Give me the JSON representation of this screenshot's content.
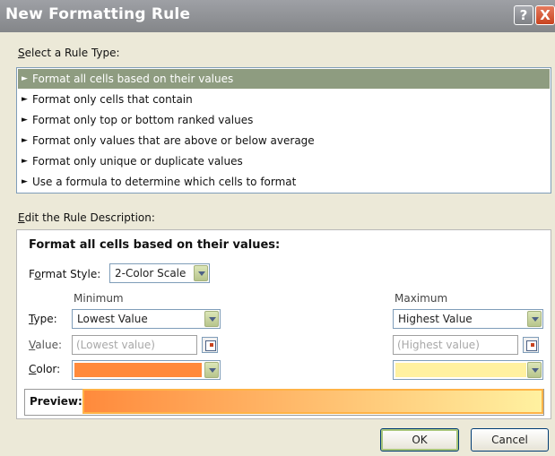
{
  "dialog": {
    "title": "New Formatting Rule",
    "help_button": "?",
    "close_button": "X"
  },
  "rule_type": {
    "label_prefix": "S",
    "label_rest": "elect a Rule Type:",
    "items": [
      {
        "label": "Format all cells based on their values",
        "selected": true
      },
      {
        "label": "Format only cells that contain",
        "selected": false
      },
      {
        "label": "Format only top or bottom ranked values",
        "selected": false
      },
      {
        "label": "Format only values that are above or below average",
        "selected": false
      },
      {
        "label": "Format only unique or duplicate values",
        "selected": false
      },
      {
        "label": "Use a formula to determine which cells to format",
        "selected": false
      }
    ],
    "arrow_glyph": "►"
  },
  "description": {
    "label_prefix": "E",
    "label_rest": "dit the Rule Description:",
    "heading": "Format all cells based on their values:",
    "format_style_label_pre": "F",
    "format_style_label_u": "o",
    "format_style_label_post": "rmat Style:",
    "format_style_value": "2-Color Scale",
    "minimum_header": "Minimum",
    "maximum_header": "Maximum",
    "type_label_u": "T",
    "type_label_rest": "ype:",
    "value_label_u": "V",
    "value_label_rest": "alue:",
    "color_label_u": "C",
    "color_label_rest": "olor:",
    "min_type": "Lowest Value",
    "max_type": "Highest Value",
    "min_value_placeholder": "(Lowest value)",
    "max_value_placeholder": "(Highest value)",
    "min_color": "#FF8A3C",
    "max_color": "#FFF1A0",
    "preview_label": "Preview:"
  },
  "buttons": {
    "ok": "OK",
    "cancel": "Cancel"
  }
}
